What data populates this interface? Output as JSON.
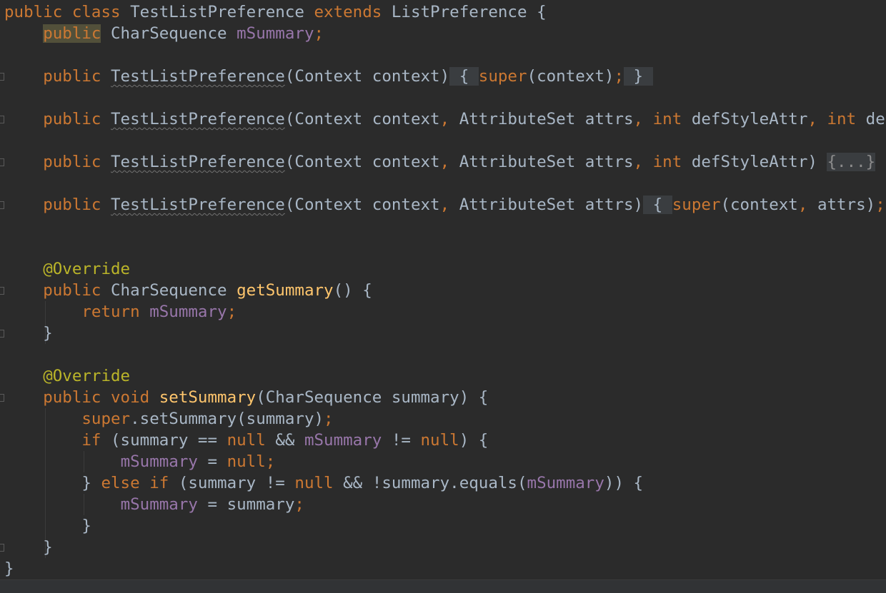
{
  "editor": {
    "lines": [
      [
        {
          "t": "public class ",
          "c": "kw"
        },
        {
          "t": "TestListPreference "
        },
        {
          "t": "extends ",
          "c": "kw"
        },
        {
          "t": "ListPreference {"
        }
      ],
      [
        {
          "t": "    "
        },
        {
          "t": "public",
          "c": "kw hl"
        },
        {
          "t": " CharSequence "
        },
        {
          "t": "mSummary",
          "c": "fld"
        },
        {
          "t": ";",
          "c": "kw"
        }
      ],
      [],
      [
        {
          "t": "    "
        },
        {
          "t": "public ",
          "c": "kw"
        },
        {
          "t": "TestListPreference",
          "c": "ctor"
        },
        {
          "t": "(Context context)"
        },
        {
          "t": " { ",
          "c": "fold"
        },
        {
          "t": "super",
          "c": "kw"
        },
        {
          "t": "(context)"
        },
        {
          "t": ";",
          "c": "kw"
        },
        {
          "t": " } ",
          "c": "fold"
        }
      ],
      [],
      [
        {
          "t": "    "
        },
        {
          "t": "public ",
          "c": "kw"
        },
        {
          "t": "TestListPreference",
          "c": "ctor"
        },
        {
          "t": "(Context context"
        },
        {
          "t": ", ",
          "c": "kw"
        },
        {
          "t": "AttributeSet attrs"
        },
        {
          "t": ", ",
          "c": "kw"
        },
        {
          "t": "int ",
          "c": "kw"
        },
        {
          "t": "defStyleAttr"
        },
        {
          "t": ", ",
          "c": "kw"
        },
        {
          "t": "int ",
          "c": "kw"
        },
        {
          "t": "def"
        }
      ],
      [],
      [
        {
          "t": "    "
        },
        {
          "t": "public ",
          "c": "kw"
        },
        {
          "t": "TestListPreference",
          "c": "ctor"
        },
        {
          "t": "(Context context"
        },
        {
          "t": ", ",
          "c": "kw"
        },
        {
          "t": "AttributeSet attrs"
        },
        {
          "t": ", ",
          "c": "kw"
        },
        {
          "t": "int ",
          "c": "kw"
        },
        {
          "t": "defStyleAttr) "
        },
        {
          "t": "{...}",
          "c": "fold-dim"
        }
      ],
      [],
      [
        {
          "t": "    "
        },
        {
          "t": "public ",
          "c": "kw"
        },
        {
          "t": "TestListPreference",
          "c": "ctor"
        },
        {
          "t": "(Context context"
        },
        {
          "t": ", ",
          "c": "kw"
        },
        {
          "t": "AttributeSet attrs)"
        },
        {
          "t": " { ",
          "c": "fold"
        },
        {
          "t": "super",
          "c": "kw"
        },
        {
          "t": "(context"
        },
        {
          "t": ", ",
          "c": "kw"
        },
        {
          "t": "attrs)"
        },
        {
          "t": ";",
          "c": "kw"
        }
      ],
      [],
      [],
      [
        {
          "t": "    "
        },
        {
          "t": "@Override",
          "c": "ann"
        }
      ],
      [
        {
          "t": "    "
        },
        {
          "t": "public ",
          "c": "kw"
        },
        {
          "t": "CharSequence "
        },
        {
          "t": "getSummary",
          "c": "fn"
        },
        {
          "t": "() {"
        }
      ],
      [
        {
          "t": "        "
        },
        {
          "t": "return ",
          "c": "kw"
        },
        {
          "t": "mSummary",
          "c": "fld"
        },
        {
          "t": ";",
          "c": "kw"
        }
      ],
      [
        {
          "t": "    }"
        }
      ],
      [],
      [
        {
          "t": "    "
        },
        {
          "t": "@Override",
          "c": "ann"
        }
      ],
      [
        {
          "t": "    "
        },
        {
          "t": "public void ",
          "c": "kw"
        },
        {
          "t": "setSummary",
          "c": "fn"
        },
        {
          "t": "(CharSequence summary) {"
        }
      ],
      [
        {
          "t": "        "
        },
        {
          "t": "super",
          "c": "kw"
        },
        {
          "t": ".setSummary(summary)"
        },
        {
          "t": ";",
          "c": "kw"
        }
      ],
      [
        {
          "t": "        "
        },
        {
          "t": "if ",
          "c": "kw"
        },
        {
          "t": "(summary == "
        },
        {
          "t": "null ",
          "c": "kw"
        },
        {
          "t": "&& "
        },
        {
          "t": "mSummary ",
          "c": "fld"
        },
        {
          "t": "!= "
        },
        {
          "t": "null",
          "c": "kw"
        },
        {
          "t": ") {"
        }
      ],
      [
        {
          "t": "            "
        },
        {
          "t": "mSummary ",
          "c": "fld"
        },
        {
          "t": "= "
        },
        {
          "t": "null",
          "c": "kw"
        },
        {
          "t": ";",
          "c": "kw"
        }
      ],
      [
        {
          "t": "        } "
        },
        {
          "t": "else if ",
          "c": "kw"
        },
        {
          "t": "(summary != "
        },
        {
          "t": "null ",
          "c": "kw"
        },
        {
          "t": "&& !summary.equals("
        },
        {
          "t": "mSummary",
          "c": "fld"
        },
        {
          "t": ")) {"
        }
      ],
      [
        {
          "t": "            "
        },
        {
          "t": "mSummary ",
          "c": "fld"
        },
        {
          "t": "= summary"
        },
        {
          "t": ";",
          "c": "kw"
        }
      ],
      [
        {
          "t": "        }"
        }
      ],
      [
        {
          "t": "    }"
        }
      ],
      [
        {
          "t": "}"
        }
      ]
    ]
  }
}
